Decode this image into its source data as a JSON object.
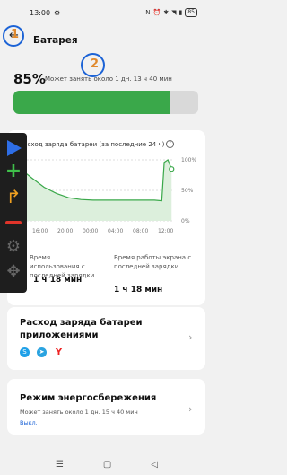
{
  "status_bar": {
    "time": "13:00",
    "battery": "85"
  },
  "header": {
    "title": "Батарея",
    "badge1": "1",
    "badge2": "2"
  },
  "summary": {
    "percent": "85%",
    "remaining": "Может занять около 1 дн. 13 ч 40 мин",
    "level": 0.85
  },
  "usage_card": {
    "title": "Расход заряда батареи (за последние 24 ч)",
    "chart_data": {
      "type": "line",
      "x_ticks": [
        "16:00",
        "20:00",
        "00:00",
        "04:00",
        "08:00",
        "12:00"
      ],
      "y_ticks": [
        "100%",
        "50%",
        "0%"
      ],
      "points": [
        [
          0,
          86
        ],
        [
          1,
          70
        ],
        [
          2,
          55
        ],
        [
          3,
          45
        ],
        [
          4,
          38
        ],
        [
          5,
          35
        ],
        [
          6,
          34
        ],
        [
          7,
          34
        ],
        [
          8,
          34
        ],
        [
          9,
          34
        ],
        [
          10,
          34
        ],
        [
          11,
          34
        ],
        [
          11.6,
          33
        ],
        [
          11.8,
          96
        ],
        [
          12.1,
          100
        ],
        [
          12.4,
          85
        ]
      ]
    },
    "stat1_label": "Время использования с последней зарядки",
    "stat1_value": "1 ч 18 мин",
    "stat2_label": "Время работы экрана с последней зарядки",
    "stat2_value": "1 ч 18 мин"
  },
  "apps_card": {
    "title": "Расход заряда батареи приложениями",
    "icons": [
      "skype-icon",
      "telegram-icon",
      "yandex-icon"
    ]
  },
  "power_saving": {
    "title": "Режим энергосбережения",
    "subtitle": "Может занять около 1 дн. 15 ч 40 мин",
    "status": "Выкл."
  }
}
